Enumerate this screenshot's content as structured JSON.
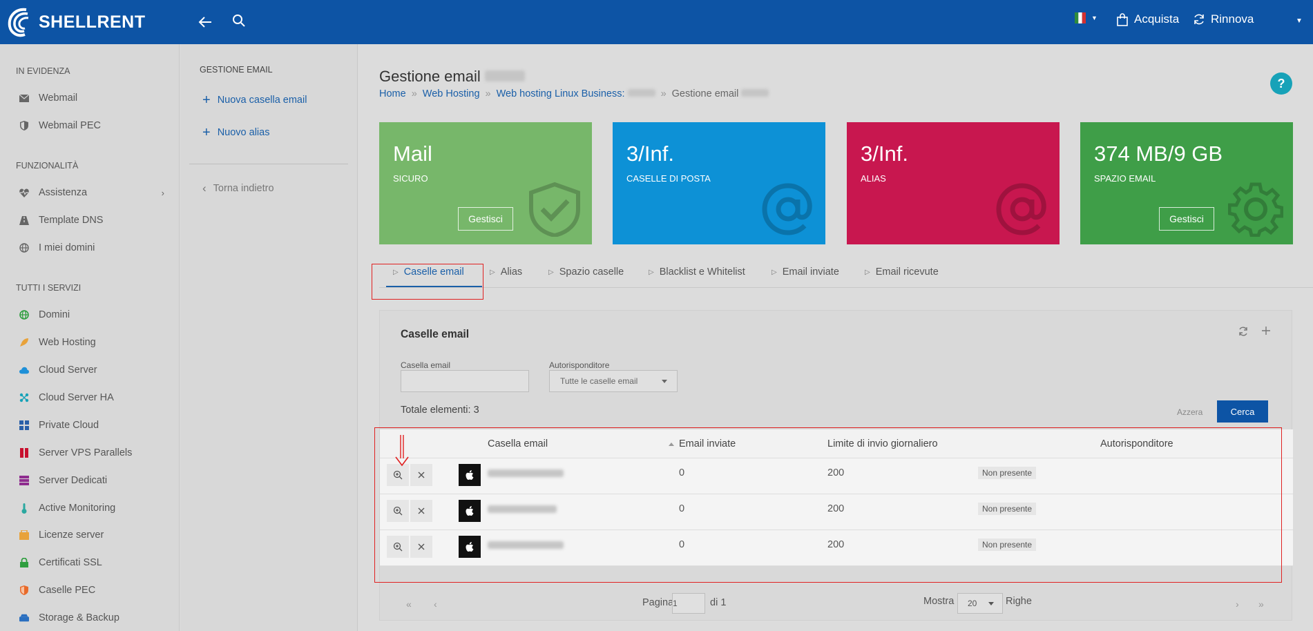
{
  "brand": {
    "name": "SHELLRENT"
  },
  "topbar": {
    "acquista": "Acquista",
    "rinnova": "Rinnova"
  },
  "sidebar": {
    "sections": [
      {
        "title": "IN EVIDENZA",
        "items": [
          {
            "label": "Webmail",
            "icon": "mail-icon"
          },
          {
            "label": "Webmail PEC",
            "icon": "shield-icon"
          }
        ]
      },
      {
        "title": "FUNZIONALITÀ",
        "items": [
          {
            "label": "Assistenza",
            "icon": "heartbeat-icon"
          },
          {
            "label": "Template DNS",
            "icon": "road-icon"
          },
          {
            "label": "I miei domini",
            "icon": "globe-icon"
          }
        ]
      },
      {
        "title": "TUTTI I SERVIZI",
        "items": [
          {
            "label": "Domini",
            "icon": "globe-icon"
          },
          {
            "label": "Web Hosting",
            "icon": "rocket-icon"
          },
          {
            "label": "Cloud Server",
            "icon": "cloud-icon"
          },
          {
            "label": "Cloud Server HA",
            "icon": "network-icon"
          },
          {
            "label": "Private Cloud",
            "icon": "grid-icon"
          },
          {
            "label": "Server VPS Parallels",
            "icon": "parallels-icon"
          },
          {
            "label": "Server Dedicati",
            "icon": "server-icon"
          },
          {
            "label": "Active Monitoring",
            "icon": "thermometer-icon"
          },
          {
            "label": "Licenze server",
            "icon": "license-icon"
          },
          {
            "label": "Certificati SSL",
            "icon": "lock-icon"
          },
          {
            "label": "Caselle PEC",
            "icon": "shield-icon"
          },
          {
            "label": "Storage & Backup",
            "icon": "storage-icon"
          }
        ]
      }
    ]
  },
  "subnav": {
    "title": "GESTIONE EMAIL",
    "new_mailbox": "Nuova casella email",
    "new_alias": "Nuovo alias",
    "back": "Torna indietro"
  },
  "page": {
    "title": "Gestione email",
    "breadcrumb": [
      "Home",
      "Web Hosting",
      "Web hosting Linux Business:",
      "Gestione email"
    ],
    "help": "?"
  },
  "cards": [
    {
      "big": "Mail",
      "sub": "SICURO",
      "button": "Gestisci",
      "color": "#77b76a",
      "icon": "shield-check-icon"
    },
    {
      "big": "3/Inf.",
      "sub": "CASELLE DI POSTA",
      "button": "",
      "color": "#0d91d6",
      "icon": "at-icon"
    },
    {
      "big": "3/Inf.",
      "sub": "ALIAS",
      "button": "",
      "color": "#c8174f",
      "icon": "at-icon"
    },
    {
      "big": "374 MB/9 GB",
      "sub": "SPAZIO EMAIL",
      "button": "Gestisci",
      "color": "#3f9e48",
      "icon": "gear-icon"
    }
  ],
  "tabs": [
    "Caselle email",
    "Alias",
    "Spazio caselle",
    "Blacklist e Whitelist",
    "Email inviate",
    "Email ricevute"
  ],
  "panel": {
    "title": "Caselle email",
    "filter_email_label": "Casella email",
    "filter_email_value": "",
    "filter_auto_label": "Autorisponditore",
    "filter_auto_value": "Tutte le caselle email",
    "total": "Totale elementi: 3",
    "reset": "Azzera",
    "search": "Cerca"
  },
  "table": {
    "headers": [
      "Casella email",
      "Email inviate",
      "Limite di invio giornaliero",
      "Autorisponditore"
    ],
    "rows": [
      {
        "sent": "0",
        "limit": "200",
        "autoresponder": "Non presente"
      },
      {
        "sent": "0",
        "limit": "200",
        "autoresponder": "Non presente"
      },
      {
        "sent": "0",
        "limit": "200",
        "autoresponder": "Non presente"
      }
    ]
  },
  "pager": {
    "page_label": "Pagina",
    "page": "1",
    "of": "di 1",
    "show": "Mostra",
    "rows": "20",
    "rows_label": "Righe"
  }
}
